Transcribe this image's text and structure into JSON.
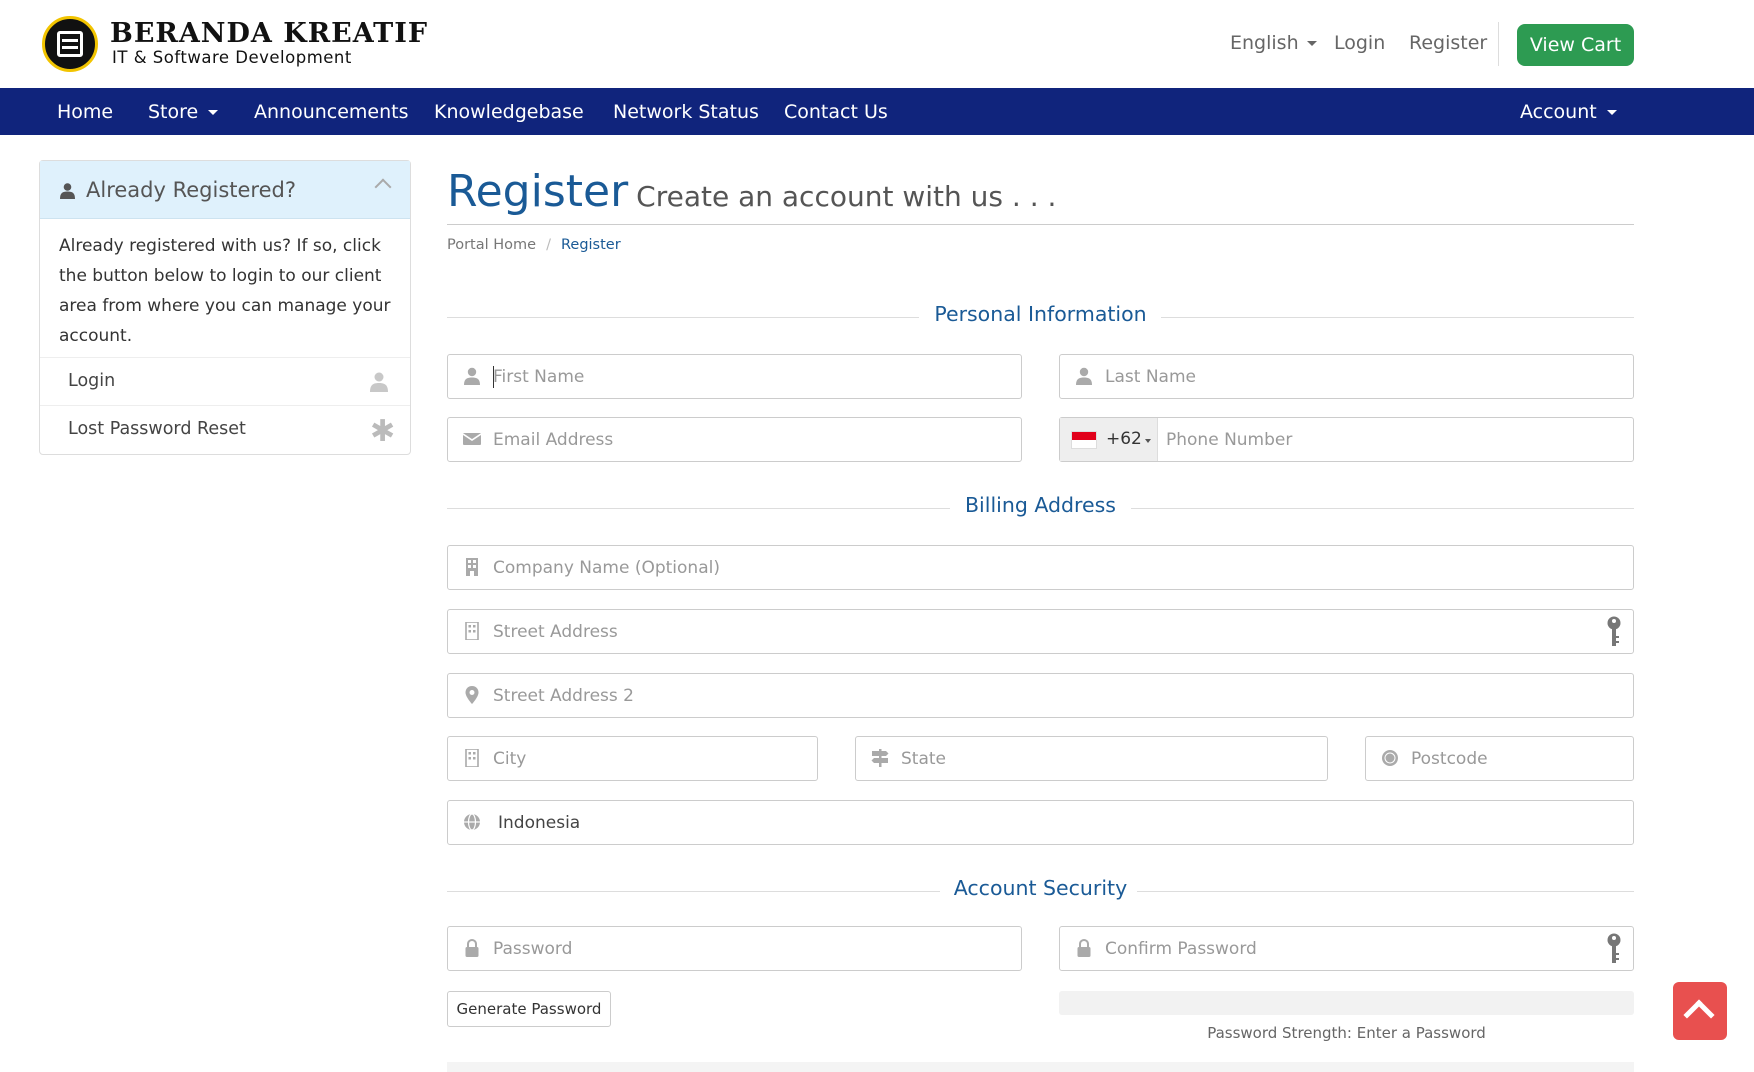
{
  "brand": {
    "title": "BERANDA KREATIF",
    "subtitle": "IT & Software Development"
  },
  "topbar": {
    "language": "English",
    "login": "Login",
    "register": "Register",
    "cart": "View Cart"
  },
  "nav": {
    "home": "Home",
    "store": "Store",
    "announcements": "Announcements",
    "knowledgebase": "Knowledgebase",
    "network_status": "Network Status",
    "contact": "Contact Us",
    "account": "Account"
  },
  "sidebar": {
    "title": "Already Registered?",
    "body": "Already registered with us? If so, click the button below to login to our client area from where you can manage your account.",
    "links": [
      {
        "label": "Login",
        "icon": "user-icon"
      },
      {
        "label": "Lost Password Reset",
        "icon": "asterisk-icon"
      }
    ]
  },
  "page": {
    "title": "Register",
    "subtitle": "Create an account with us . . ."
  },
  "breadcrumb": {
    "home": "Portal Home",
    "current": "Register"
  },
  "sections": {
    "personal": "Personal Information",
    "billing": "Billing Address",
    "security": "Account Security"
  },
  "fields": {
    "first_name": "First Name",
    "last_name": "Last Name",
    "email": "Email Address",
    "phone_code": "+62",
    "phone": "Phone Number",
    "company": "Company Name (Optional)",
    "street": "Street Address",
    "street2": "Street Address 2",
    "city": "City",
    "state": "State",
    "postcode": "Postcode",
    "country": "Indonesia",
    "password": "Password",
    "confirm_password": "Confirm Password"
  },
  "security": {
    "generate": "Generate Password",
    "strength": "Password Strength: Enter a Password"
  },
  "colors": {
    "nav": "#10247c",
    "accent": "#1a5a96",
    "cart": "#2d9b52",
    "to_top": "#e8504f"
  }
}
